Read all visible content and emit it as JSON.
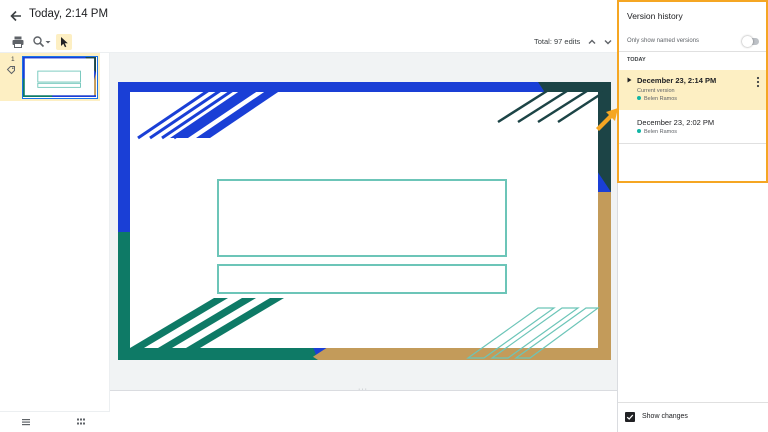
{
  "header": {
    "title": "Today, 2:14 PM"
  },
  "toolbar": {
    "edits": "Total: 97 edits"
  },
  "thumbnails": {
    "slide_number": "1"
  },
  "version_panel": {
    "title": "Version history",
    "only_named_label": "Only show named versions",
    "only_named_enabled": false,
    "section_label": "TODAY",
    "versions": [
      {
        "date": "December 23, 2:14 PM",
        "subtitle": "Current version",
        "user": "Belen Ramos"
      },
      {
        "date": "December 23, 2:02 PM",
        "user": "Belen Ramos"
      }
    ],
    "show_changes_label": "Show changes",
    "show_changes_checked": true
  },
  "colors": {
    "blue": "#1a3fd6",
    "dark_teal": "#1c4446",
    "green": "#0e7a66",
    "gold": "#c39b5a",
    "outline_teal": "#6cc5b8",
    "selection": "#fdefc3",
    "highlight": "#f5a623"
  }
}
